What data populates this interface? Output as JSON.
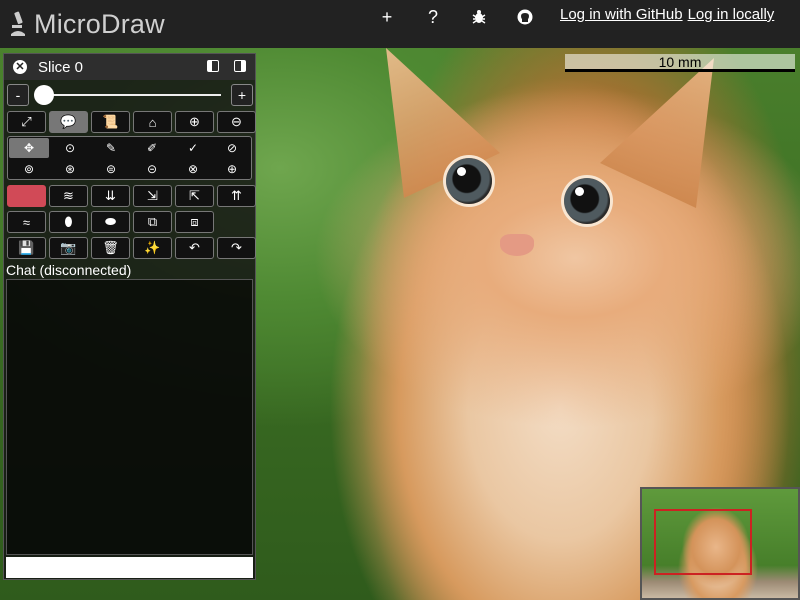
{
  "app": {
    "title": "MicroDraw"
  },
  "topbar": {
    "icons": [
      {
        "name": "add-icon",
        "glyph": "+"
      },
      {
        "name": "help-icon",
        "glyph": "?"
      },
      {
        "name": "bug-icon",
        "glyph": "🐞"
      },
      {
        "name": "github-icon",
        "glyph": "◉"
      }
    ],
    "login_github": "Log in with GitHub",
    "login_local": "Log in locally"
  },
  "viewer": {
    "scale_label": "10 mm"
  },
  "panel": {
    "title": "Slice 0",
    "slider": {
      "minus": "-",
      "plus": "+"
    },
    "chat_label": "Chat (disconnected)",
    "chat_input_value": "",
    "chat_input_placeholder": ""
  },
  "toolbar_rows": [
    [
      "⤢",
      "💬",
      "📜",
      "⌂",
      "⊕",
      "⊖"
    ],
    [],
    [
      "",
      "≋",
      "⇊",
      "⇲",
      "⇱",
      "⇈"
    ],
    [
      "≈",
      "⬮",
      "⬬",
      "⧉",
      "⧈"
    ],
    [
      "💾",
      "📷",
      "🗑",
      "✨",
      "↶",
      "↷"
    ]
  ],
  "grid_tools": [
    "✥",
    "⊙",
    "✎",
    "✐",
    "✓",
    "⊘",
    "⊚",
    "⊛",
    "⊜",
    "⊝",
    "⊗",
    "⊕"
  ],
  "colors": {
    "topbar_bg": "#222222",
    "panel_bg": "#141414",
    "active_tool": "#777777",
    "color_swatch": "#d14a57",
    "navigator_rect": "#cc2222"
  }
}
